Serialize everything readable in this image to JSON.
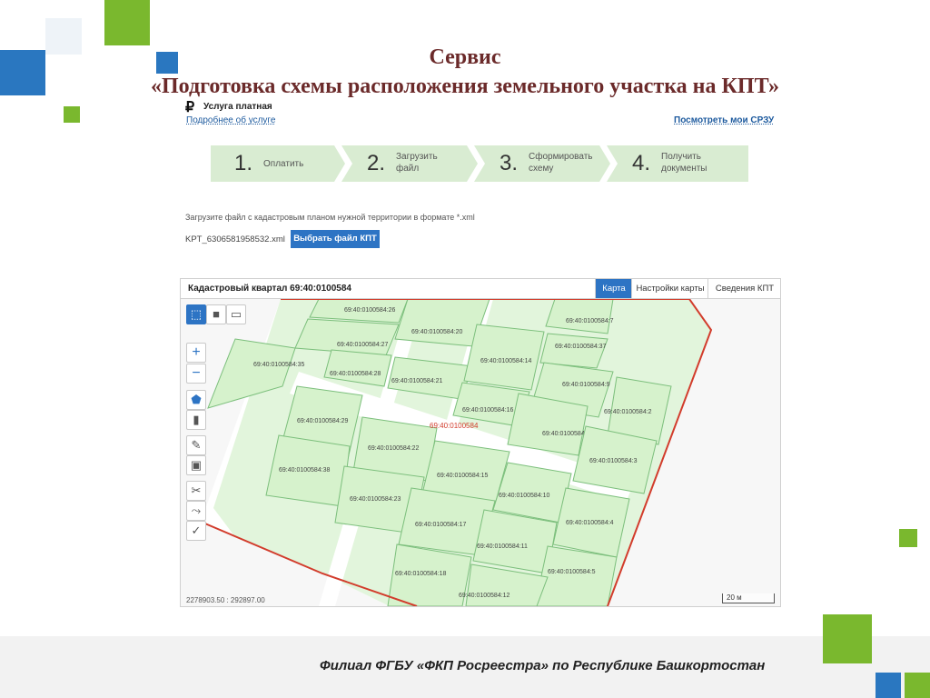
{
  "slide": {
    "title_line1": "Сервис",
    "title_line2": "«Подготовка схемы расположения земельного участка на КПТ»",
    "footer": "Филиал ФГБУ «ФКП Росреестра» по Республике Башкортостан"
  },
  "colors": {
    "brand_green": "#7ab82e",
    "brand_blue": "#2a77c0",
    "title": "#6b2a2a",
    "parcel_fill": "#d6f2cc",
    "parcel_stroke": "#7cbf7c",
    "boundary": "#d23c2c",
    "step_bg": "#d9ecd2"
  },
  "service": {
    "currency_icon": "ruble-icon",
    "paid_label": "Услуга платная",
    "more_link": "Подробнее об услуге",
    "my_link": "Посмотреть мои СРЗУ"
  },
  "steps": [
    {
      "num": "1.",
      "label": "Оплатить"
    },
    {
      "num": "2.",
      "label": "Загрузить файл"
    },
    {
      "num": "3.",
      "label": "Сформировать схему"
    },
    {
      "num": "4.",
      "label": "Получить документы"
    }
  ],
  "upload": {
    "instruction": "Загрузите файл с кадастровым планом нужной территории в формате *.xml",
    "filename": "KPT_6306581958532.xml",
    "button": "Выбрать файл КПТ"
  },
  "map": {
    "title": "Кадастровый квартал 69:40:0100584",
    "tabs": [
      "Карта",
      "Настройки карты",
      "Сведения КПТ"
    ],
    "active_tab": "Карта",
    "center_label": "69:40:0100584",
    "coords": "2278903.50 : 292897.00",
    "scale": "20 м",
    "tools": [
      "select-polygon-icon",
      "fill-icon",
      "layers-icon",
      "zoom-in-icon",
      "zoom-out-icon",
      "draw-polygon-icon",
      "delete-icon",
      "edit-icon",
      "save-icon",
      "cut-icon",
      "split-icon",
      "confirm-icon"
    ],
    "parcels": [
      "69:40:0100584:26",
      "69:40:0100584:20",
      "69:40:0100584:27",
      "69:40:0100584:35",
      "69:40:0100584:28",
      "69:40:0100584:21",
      "69:40:0100584:14",
      "69:40:0100584:7",
      "69:40:0100584:37",
      "69:40:0100584:9",
      "69:40:0100584:16",
      "69:40:0100584:2",
      "69:40:0100584:29",
      "69:40:0100584:8",
      "69:40:0100584:22",
      "69:40:0100584:3",
      "69:40:0100584:38",
      "69:40:0100584:15",
      "69:40:0100584:10",
      "69:40:0100584:23",
      "69:40:0100584:17",
      "69:40:0100584:4",
      "69:40:0100584:11",
      "69:40:0100584:18",
      "69:40:0100584:5",
      "69:40:0100584:12"
    ]
  }
}
